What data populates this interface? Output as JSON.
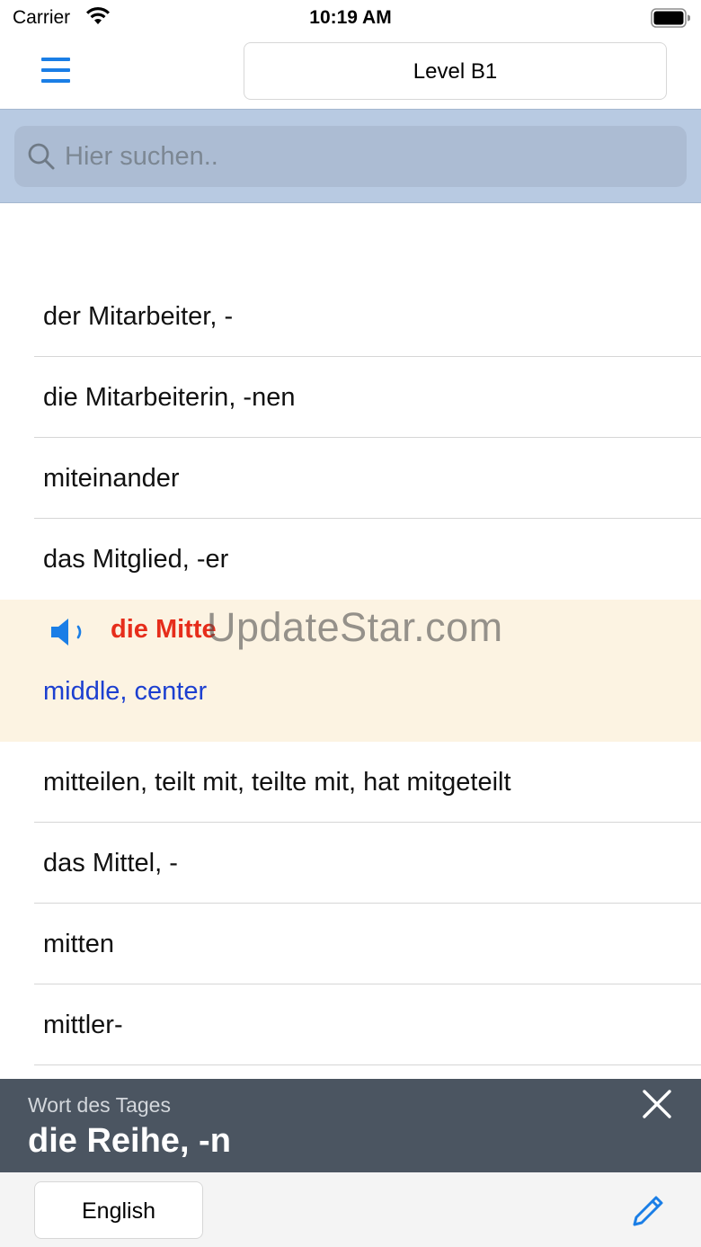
{
  "status_bar": {
    "carrier": "Carrier",
    "time": "10:19 AM",
    "icons": [
      "wifi-icon",
      "battery-icon"
    ]
  },
  "nav": {
    "menu_icon": "hamburger-menu-icon",
    "level_label": "Level B1"
  },
  "search": {
    "icon": "search-icon",
    "placeholder": "Hier suchen.."
  },
  "words": [
    "der Mitarbeiter, -",
    "die Mitarbeiterin, -nen",
    "miteinander",
    "das Mitglied, -er"
  ],
  "expanded_word": {
    "icon": "speaker-icon",
    "word": "die Mitte",
    "translation": "middle, center"
  },
  "words_after": [
    "mitteilen, teilt mit, teilte mit, hat mitgeteilt",
    "das Mittel, -",
    "mitten",
    "mittler-"
  ],
  "watermark": "UpdateStar.com",
  "word_of_the_day": {
    "caption": "Wort des Tages",
    "word": "die Reihe, -n",
    "close_icon": "close-icon"
  },
  "bottom_bar": {
    "language_label": "English",
    "edit_icon": "pencil-icon"
  },
  "colors": {
    "accent": "#1a7ee6",
    "search_bg": "#b8cae2",
    "highlight_bg": "#fcf3e2",
    "highlight_word": "#e62d1b",
    "translation": "#1c3fd0",
    "wotd_bg": "#4b5561"
  }
}
